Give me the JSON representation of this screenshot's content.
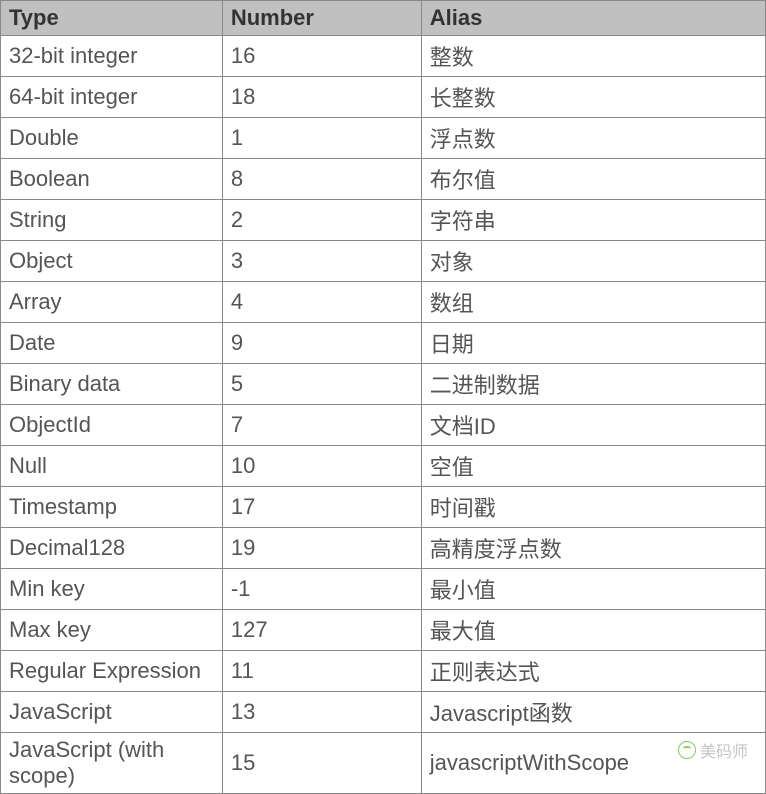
{
  "chart_data": {
    "type": "table",
    "columns": [
      "Type",
      "Number",
      "Alias"
    ],
    "rows": [
      [
        "32-bit integer",
        "16",
        "整数"
      ],
      [
        "64-bit integer",
        "18",
        "长整数"
      ],
      [
        "Double",
        "1",
        "浮点数"
      ],
      [
        "Boolean",
        "8",
        "布尔值"
      ],
      [
        "String",
        "2",
        "字符串"
      ],
      [
        "Object",
        "3",
        "对象"
      ],
      [
        "Array",
        "4",
        "数组"
      ],
      [
        "Date",
        "9",
        "日期"
      ],
      [
        "Binary data",
        "5",
        "二进制数据"
      ],
      [
        "ObjectId",
        "7",
        "文档ID"
      ],
      [
        "Null",
        "10",
        "空值"
      ],
      [
        "Timestamp",
        "17",
        "时间戳"
      ],
      [
        "Decimal128",
        "19",
        "高精度浮点数"
      ],
      [
        "Min key",
        "-1",
        "最小值"
      ],
      [
        "Max key",
        "127",
        "最大值"
      ],
      [
        "Regular Expression",
        "11",
        "正则表达式"
      ],
      [
        "JavaScript",
        "13",
        "Javascript函数"
      ],
      [
        "JavaScript (with scope)",
        "15",
        "javascriptWithScope"
      ]
    ]
  },
  "headers": {
    "type": "Type",
    "number": "Number",
    "alias": "Alias"
  },
  "watermark": {
    "text": "美码师"
  }
}
